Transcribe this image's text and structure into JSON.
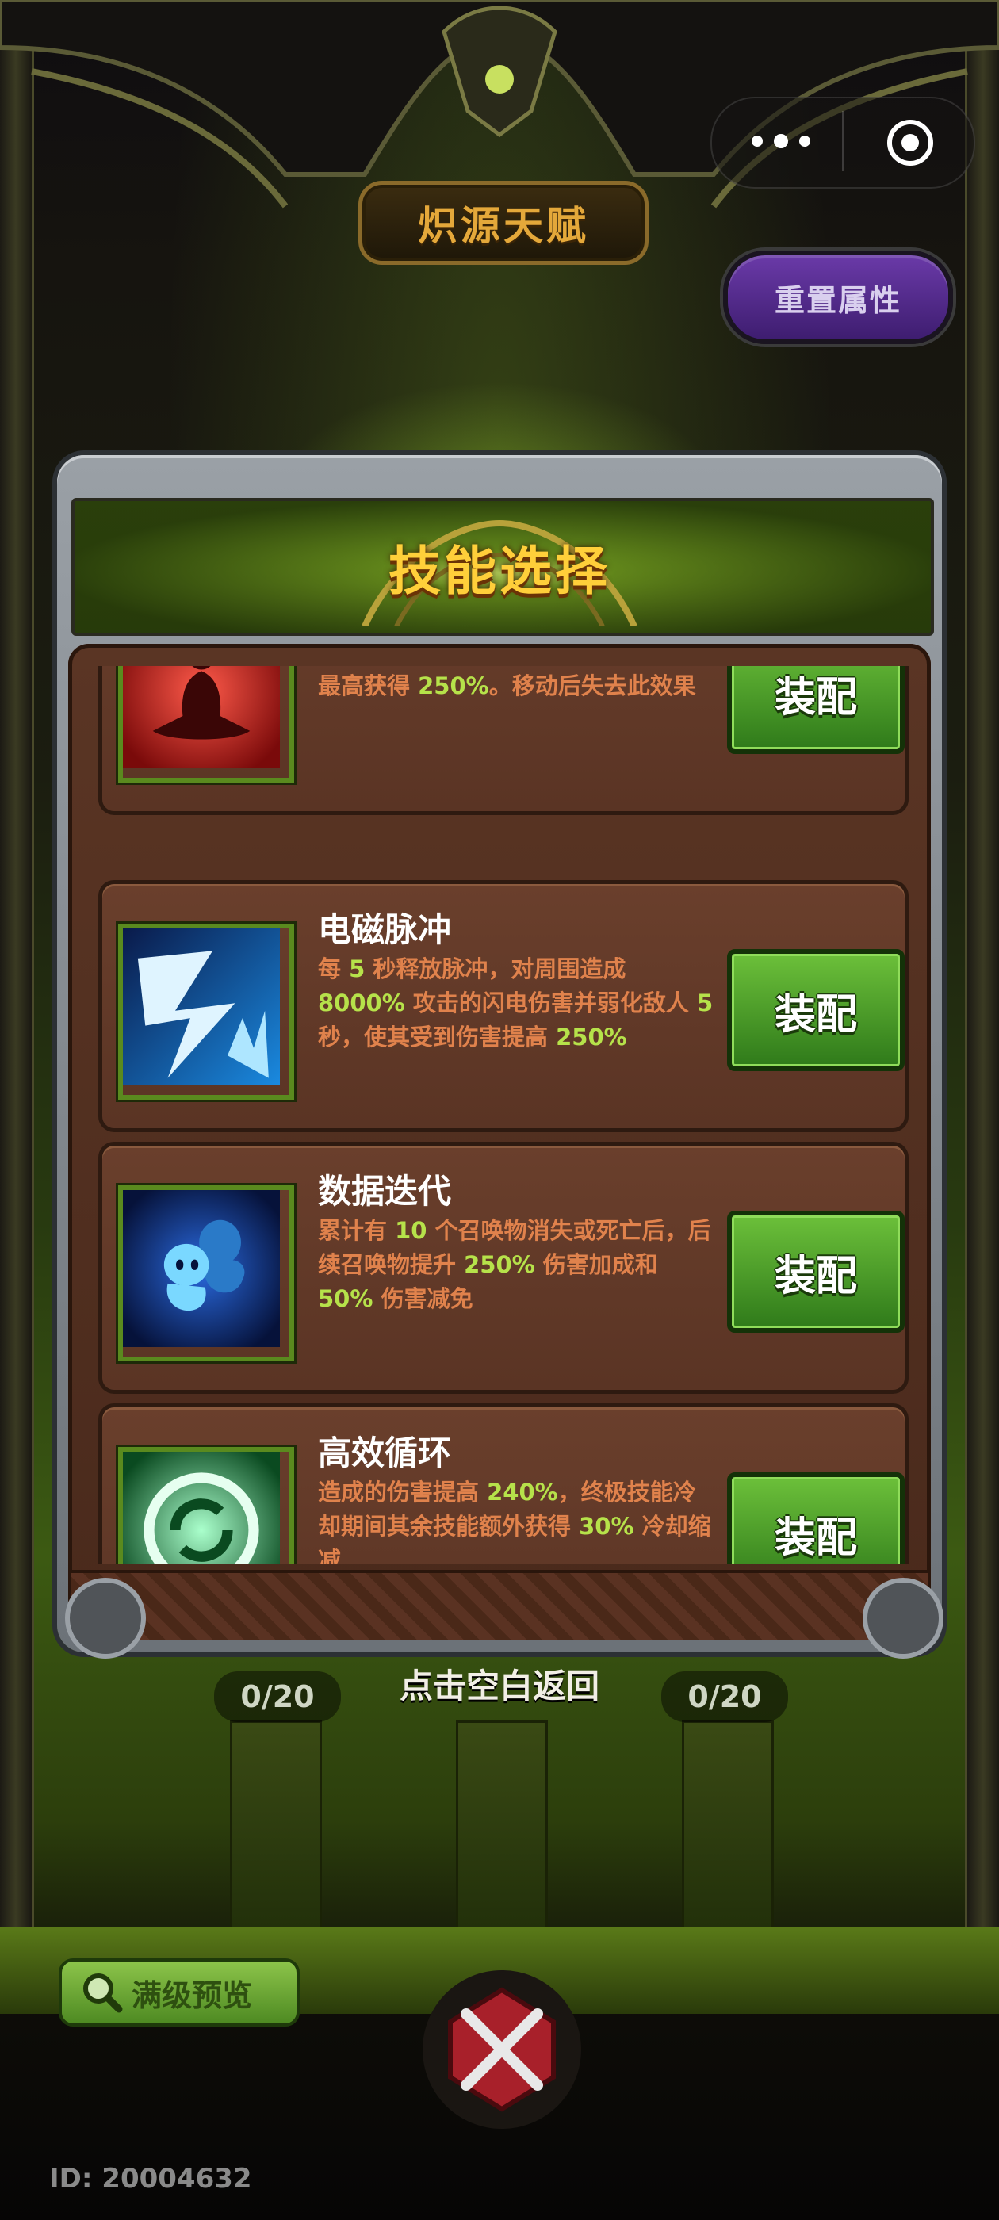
{
  "header": {
    "title": "炽源天赋",
    "reset_button": "重置属性"
  },
  "mini_program_menu": {
    "more_icon": "more-dots-icon",
    "close_icon": "target-close-icon"
  },
  "dialog": {
    "title": "技能选择",
    "skills": [
      {
        "name": "",
        "icon": "meditation-figure-icon",
        "desc_parts": [
          "原地不动时获得逐渐提高的伤害加成，最高获得 ",
          "250%",
          "。移动后失去此效果"
        ],
        "button": "装配"
      },
      {
        "name": "电磁脉冲",
        "icon": "lightning-strike-icon",
        "desc_parts": [
          "每 ",
          "5",
          " 秒释放脉冲，对周围造成 ",
          "8000%",
          " 攻击的闪电伤害并弱化敌人 ",
          "5",
          " 秒，使其受到伤害提高 ",
          "250%"
        ],
        "button": "装配"
      },
      {
        "name": "数据迭代",
        "icon": "summon-spirits-icon",
        "desc_parts": [
          "累计有 ",
          "10",
          " 个召唤物消失或死亡后，后续召唤物提升 ",
          "250%",
          " 伤害加成和 ",
          "50%",
          " 伤害减免"
        ],
        "button": "装配"
      },
      {
        "name": "高效循环",
        "icon": "green-swirl-icon",
        "desc_parts": [
          "造成的伤害提高 ",
          "240%",
          "，终极技能冷却期间其余技能额外获得 ",
          "30%",
          " 冷却缩减"
        ],
        "button": "装配"
      }
    ],
    "dismiss_hint": "点击空白返回"
  },
  "counters": [
    "0/20",
    "0/20"
  ],
  "footer": {
    "preview_button": "满级预览",
    "preview_icon": "magnifier-icon",
    "emblem_icon": "crossed-swords-emblem-icon",
    "user_id": "ID: 20004632"
  },
  "colors": {
    "title_gold": "#e4a83a",
    "desc_orange": "#e0824c",
    "highlight_green": "#b6e24a",
    "button_green": "#4aa02a",
    "reset_purple": "#5a2e94"
  }
}
